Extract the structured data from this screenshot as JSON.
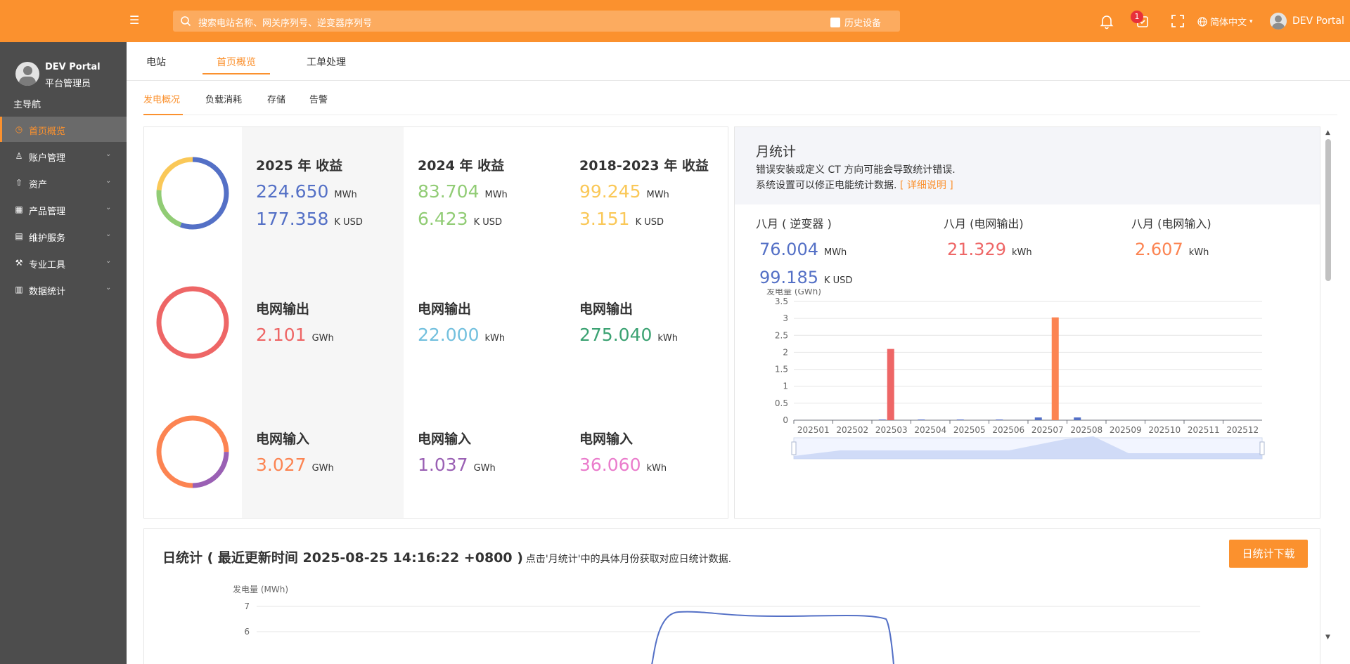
{
  "header": {
    "search_placeholder": "搜索电站名称、网关序列号、逆变器序列号",
    "history_label": "历史设备",
    "badge_count": "1",
    "language": "简体中文",
    "user": "DEV Portal"
  },
  "sidebar": {
    "user_name": "DEV Portal",
    "user_role": "平台管理员",
    "section": "主导航",
    "items": [
      {
        "label": "首页概览",
        "icon": "home-icon"
      },
      {
        "label": "账户管理",
        "icon": "user-icon"
      },
      {
        "label": "资产",
        "icon": "rocket-icon"
      },
      {
        "label": "产品管理",
        "icon": "grid-icon"
      },
      {
        "label": "维护服务",
        "icon": "wrench-doc-icon"
      },
      {
        "label": "专业工具",
        "icon": "tool-icon"
      },
      {
        "label": "数据统计",
        "icon": "bar-chart-icon"
      }
    ]
  },
  "tabs": [
    "电站",
    "首页概览",
    "工单处理"
  ],
  "subtabs": [
    "发电概况",
    "负载消耗",
    "存储",
    "告警"
  ],
  "stats": {
    "row1": [
      {
        "title": "2025 年 收益",
        "v1": "224.650",
        "u1": "MWh",
        "v2": "177.358",
        "u2": "K USD"
      },
      {
        "title": "2024 年 收益",
        "v1": "83.704",
        "u1": "MWh",
        "v2": "6.423",
        "u2": "K USD"
      },
      {
        "title": "2018-2023 年 收益",
        "v1": "99.245",
        "u1": "MWh",
        "v2": "3.151",
        "u2": "K USD"
      }
    ],
    "row2": [
      {
        "title": "电网输出",
        "v1": "2.101",
        "u1": "GWh"
      },
      {
        "title": "电网输出",
        "v1": "22.000",
        "u1": "kWh"
      },
      {
        "title": "电网输出",
        "v1": "275.040",
        "u1": "kWh"
      }
    ],
    "row3": [
      {
        "title": "电网输入",
        "v1": "3.027",
        "u1": "GWh"
      },
      {
        "title": "电网输入",
        "v1": "1.037",
        "u1": "GWh"
      },
      {
        "title": "电网输入",
        "v1": "36.060",
        "u1": "kWh"
      }
    ],
    "colors": {
      "blue": "#5470c6",
      "green": "#91cc75",
      "yellow": "#fac858",
      "red": "#ee6666",
      "cyan": "#73c0de",
      "teal": "#3ba272",
      "orange": "#fc8452",
      "purple": "#9a60b4",
      "pink": "#ea7ccc"
    }
  },
  "month": {
    "title": "月统计",
    "note1": "错误安装或定义 CT 方向可能会导致统计错误.",
    "note2": "系统设置可以修正电能统计数据.",
    "link": "[ 详细说明 ]",
    "stats": [
      {
        "title": "八月 ( 逆变器 )",
        "v1": "76.004",
        "u1": "MWh",
        "v2": "99.185",
        "u2": "K USD"
      },
      {
        "title": "八月 (电网输出)",
        "v1": "21.329",
        "u1": "kWh"
      },
      {
        "title": "八月 (电网输入)",
        "v1": "2.607",
        "u1": "kWh"
      }
    ]
  },
  "daily": {
    "title": "日统计 ( 最近更新时间 2025-08-25 14:16:22 +0800 )",
    "note": "点击'月统计'中的具体月份获取对应日统计数据.",
    "download": "日统计下载"
  },
  "chart_data": [
    {
      "type": "bar",
      "ylabel": "发电量 (GWh)",
      "ylim": [
        0,
        3.5
      ],
      "yticks": [
        "0",
        "0.5",
        "1",
        "1.5",
        "2",
        "2.5",
        "3",
        "3.5"
      ],
      "categories": [
        "202501",
        "202502",
        "202503",
        "202504",
        "202505",
        "202506",
        "202507",
        "202508",
        "202509",
        "202510",
        "202511",
        "202512"
      ],
      "series": [
        {
          "color": "#5470c6",
          "values": [
            0,
            0,
            0.02,
            0.02,
            0.02,
            0.02,
            0.08,
            0.08,
            0,
            0,
            0,
            0
          ]
        },
        {
          "color": "#ee6666",
          "values": [
            0,
            0,
            2.1,
            0,
            0,
            0,
            0,
            0,
            0,
            0,
            0,
            0
          ]
        },
        {
          "color": "#fc8452",
          "values": [
            0,
            0,
            0,
            0,
            0,
            0,
            3.03,
            0,
            0,
            0,
            0,
            0
          ]
        }
      ],
      "grid": true
    },
    {
      "type": "line",
      "ylabel": "发电量 (MWh)",
      "yticks": [
        "7",
        "6"
      ],
      "series": [
        {
          "color": "#5470c6"
        }
      ],
      "grid": true
    }
  ]
}
